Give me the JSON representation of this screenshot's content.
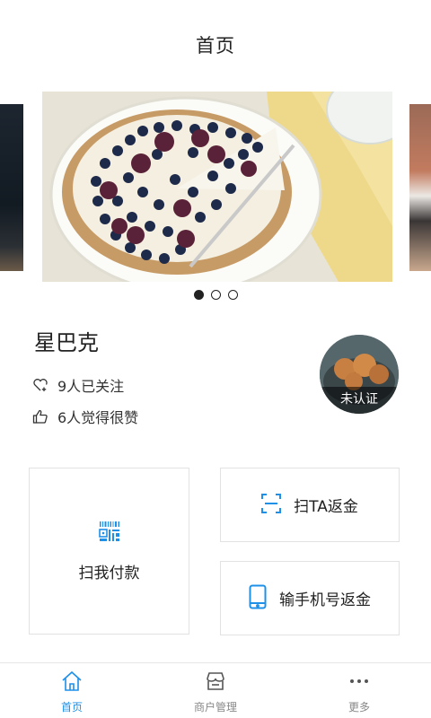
{
  "header": {
    "title": "首页"
  },
  "carousel": {
    "slide_count": 3,
    "active_index": 0
  },
  "store": {
    "name": "星巴克",
    "followers_text": "9人已关注",
    "likes_text": "6人觉得很赞",
    "avatar_badge": "未认证"
  },
  "actions": {
    "pay_label": "扫我付款",
    "scan_label": "扫TA返金",
    "phone_label": "输手机号返金"
  },
  "tabbar": {
    "items": [
      {
        "label": "首页",
        "icon": "home-icon",
        "active": true
      },
      {
        "label": "商户管理",
        "icon": "store-icon",
        "active": false
      },
      {
        "label": "更多",
        "icon": "more-icon",
        "active": false
      }
    ]
  },
  "colors": {
    "accent": "#1e90e8",
    "text": "#222222",
    "border": "#e2e2e2"
  }
}
